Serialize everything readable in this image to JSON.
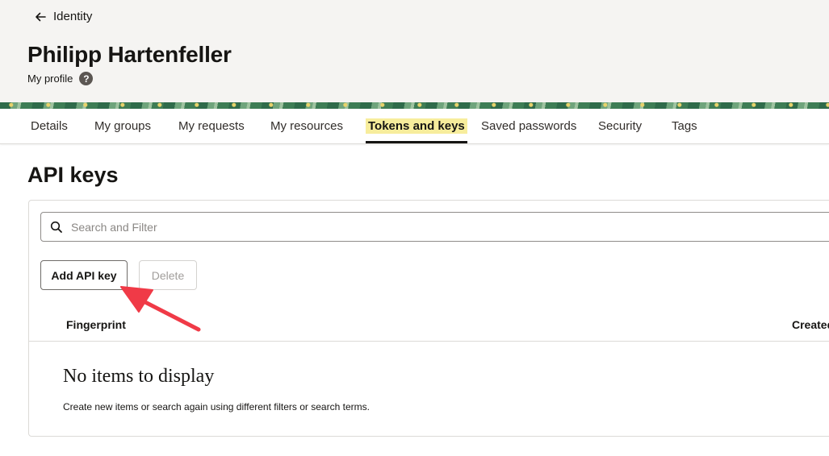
{
  "header": {
    "back_label": "Identity",
    "title": "Philipp Hartenfeller",
    "subtitle": "My profile",
    "help_glyph": "?"
  },
  "tabs": [
    {
      "label": "Details"
    },
    {
      "label": "My groups"
    },
    {
      "label": "My requests"
    },
    {
      "label": "My resources"
    },
    {
      "label": "Tokens and keys",
      "active": true
    },
    {
      "label": "Saved passwords"
    },
    {
      "label": "Security"
    },
    {
      "label": "Tags"
    }
  ],
  "section": {
    "title": "API keys",
    "search_placeholder": "Search and Filter",
    "add_button": "Add API key",
    "delete_button": "Delete",
    "columns": [
      "Fingerprint",
      "Created"
    ],
    "empty_title": "No items to display",
    "empty_description": "Create new items or search again using different filters or search terms."
  },
  "icons": {
    "back": "arrow-left-icon",
    "help": "question-circle-icon",
    "search": "search-icon"
  },
  "colors": {
    "active_tab_highlight": "#f7ed9c",
    "annotation_arrow": "#f03a47"
  }
}
